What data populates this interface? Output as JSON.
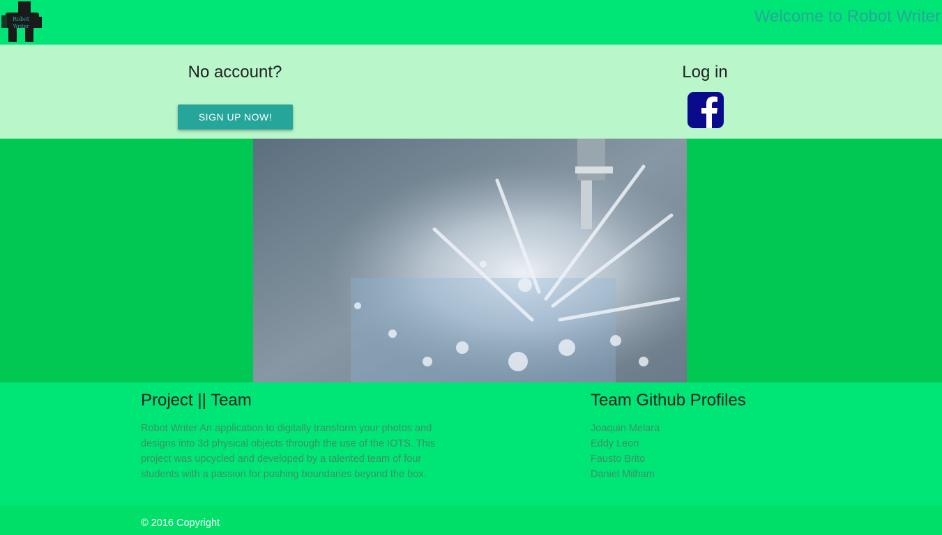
{
  "header": {
    "logo_text_line1": "Robot",
    "logo_text_line2": "Writer",
    "welcome": "Welcome to Robot Writer"
  },
  "account": {
    "signup_title": "No account?",
    "signup_button": "SIGN UP NOW!",
    "login_title": "Log in",
    "login_icon": "facebook-icon"
  },
  "hero": {
    "image": "milling-machine-splash-photo"
  },
  "project": {
    "title": "Project || Team",
    "description": "Robot Writer An application to digitally transform your photos and designs into 3d physical objects through the use of the IOTS. This project was upcycled and developed by a talented team of four students with a passion for pushing boundaries beyond the box."
  },
  "team": {
    "title": "Team Github Profiles",
    "members": [
      "Joaquin Melara",
      "Eddy Leon",
      "Fausto Brito",
      "Daniel Milham"
    ]
  },
  "footer": {
    "copyright": "© 2016 Copyright"
  },
  "colors": {
    "primary": "#00e676",
    "hero_bg": "#00c853",
    "account_bg": "#b9f6ca",
    "accent": "#26a69a",
    "facebook": "#0a0a8c"
  }
}
